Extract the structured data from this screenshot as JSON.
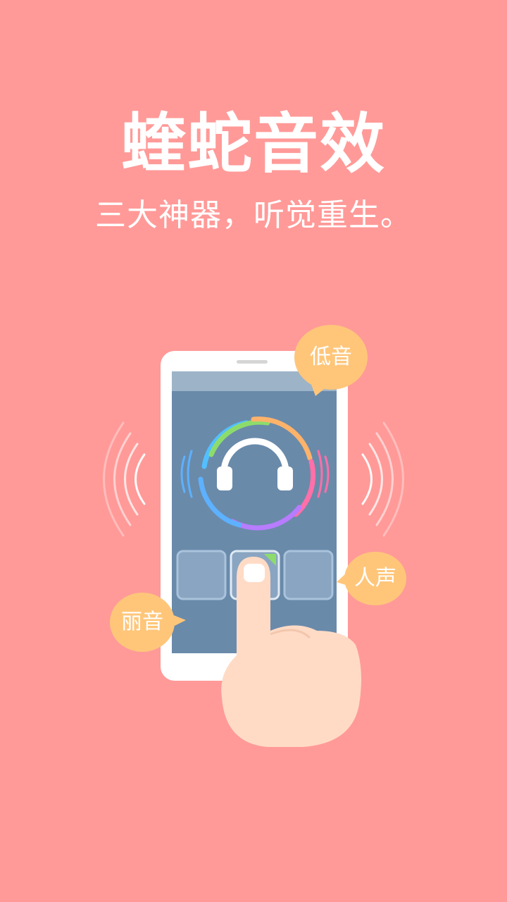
{
  "app": {
    "title": "蝰蛇音效",
    "subtitle": "三大神器，听觉重生。"
  },
  "bubbles": {
    "bass": "低音",
    "voice": "人声",
    "clear": "丽音"
  },
  "icons": {
    "center": "headphones-icon",
    "hand": "finger-tap-icon"
  },
  "colors": {
    "background": "#ff9a98",
    "screen": "#6a8aaa",
    "bubble": "#ffc67a",
    "skin": "#ffdbc6"
  }
}
